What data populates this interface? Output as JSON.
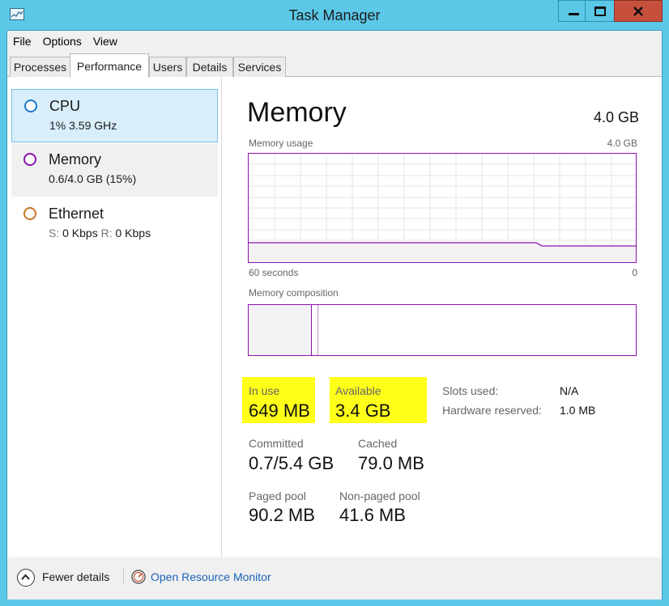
{
  "window": {
    "title": "Task Manager",
    "app_icon": "task-manager-icon",
    "controls": [
      "minimize-icon",
      "maximize-icon",
      "close-icon"
    ]
  },
  "menu": [
    "File",
    "Options",
    "View"
  ],
  "tabs": [
    {
      "label": "Processes",
      "active": false
    },
    {
      "label": "Performance",
      "active": true
    },
    {
      "label": "Users",
      "active": false
    },
    {
      "label": "Details",
      "active": false
    },
    {
      "label": "Services",
      "active": false
    }
  ],
  "sidebar": {
    "items": [
      {
        "name": "CPU",
        "sub_a": "1%",
        "sub_b": "3.59 GHz",
        "color": "#1979ca",
        "selected": true
      },
      {
        "name": "Memory",
        "sub_a": "0.6/4.0 GB (15%)",
        "color": "#8b12ae",
        "selected": false
      },
      {
        "name": "Ethernet",
        "sub_s_label": "S:",
        "sub_s_value": "0 Kbps",
        "sub_r_label": "R:",
        "sub_r_value": "0 Kbps",
        "color": "#a74f01",
        "selected": false
      }
    ]
  },
  "main": {
    "title": "Memory",
    "total": "4.0 GB",
    "usage_graph": {
      "label": "Memory usage",
      "max_label": "4.0 GB",
      "time_left": "60 seconds",
      "time_right": "0",
      "fill_color": "#f4f2f4",
      "line_color": "#8b12ae"
    },
    "composition_graph": {
      "label": "Memory composition"
    },
    "stats": {
      "in_use_label": "In use",
      "in_use_value": "649 MB",
      "available_label": "Available",
      "available_value": "3.4 GB",
      "committed_label": "Committed",
      "committed_value": "0.7/5.4 GB",
      "cached_label": "Cached",
      "cached_value": "79.0 MB",
      "paged_label": "Paged pool",
      "paged_value": "90.2 MB",
      "nonpaged_label": "Non-paged pool",
      "nonpaged_value": "41.6 MB"
    },
    "specs": {
      "slots_label": "Slots used:",
      "slots_value": "N/A",
      "hw_label": "Hardware reserved:",
      "hw_value": "1.0 MB"
    }
  },
  "footer": {
    "fewer_details": "Fewer details",
    "fewer_icon": "chevron-up-icon",
    "resource_monitor": "Open Resource Monitor",
    "resource_icon": "resource-monitor-icon"
  }
}
